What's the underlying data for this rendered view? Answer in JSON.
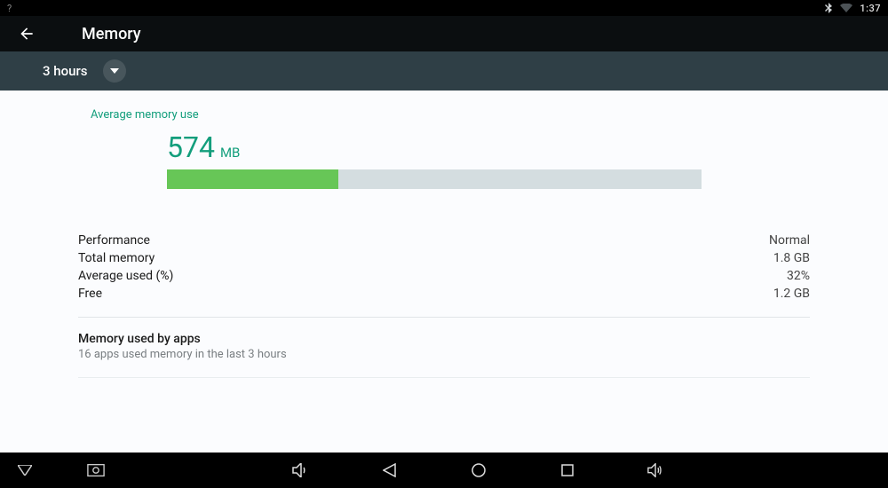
{
  "status": {
    "left_hint": "?",
    "clock": "1:37"
  },
  "header": {
    "title": "Memory"
  },
  "range": {
    "label": "3 hours"
  },
  "memory": {
    "average_label": "Average memory use",
    "average_value": "574",
    "average_unit": "MB",
    "bar_percent": 32
  },
  "stats": {
    "performance_label": "Performance",
    "performance_value": "Normal",
    "total_label": "Total memory",
    "total_value": "1.8 GB",
    "avg_pct_label": "Average used (%)",
    "avg_pct_value": "32%",
    "free_label": "Free",
    "free_value": "1.2 GB"
  },
  "apps": {
    "title": "Memory used by apps",
    "subtitle": "16 apps used memory in the last 3 hours"
  }
}
